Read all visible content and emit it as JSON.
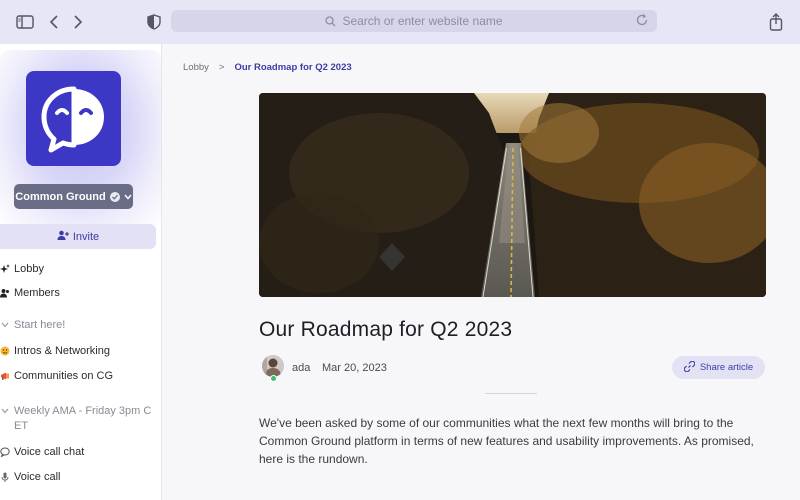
{
  "browser": {
    "address_placeholder": "Search or enter website name"
  },
  "sidebar": {
    "community_name": "Common Ground",
    "invite_label": "Invite",
    "items": [
      {
        "label": "Lobby",
        "icon": "sparkles-icon"
      },
      {
        "label": "Members",
        "icon": "people-icon"
      },
      {
        "label": "Start here!",
        "icon": "chevron-down-icon"
      },
      {
        "label": "Intros & Networking",
        "icon": "hugging-face-emoji"
      },
      {
        "label": "Communities on CG",
        "icon": "megaphone-emoji"
      },
      {
        "label": "Weekly AMA - Friday 3pm C ET",
        "icon": "chevron-down-icon"
      },
      {
        "label": "Voice call chat",
        "icon": "chat-bubble-icon"
      },
      {
        "label": "Voice call",
        "icon": "microphone-icon"
      }
    ]
  },
  "breadcrumb": {
    "root": "Lobby",
    "separator": ">",
    "current": "Our Roadmap for Q2 2023"
  },
  "article": {
    "title": "Our Roadmap for Q2 2023",
    "author": "ada",
    "date": "Mar 20, 2023",
    "share_label": "Share article",
    "body": "We've been asked by some of our communities what the next few months will bring to the Common Ground platform in terms of new features and usability improvements. As promised, here is the rundown."
  },
  "colors": {
    "accent": "#3d37c6",
    "toolbar": "#e7e6f6",
    "online": "#36c46e"
  }
}
